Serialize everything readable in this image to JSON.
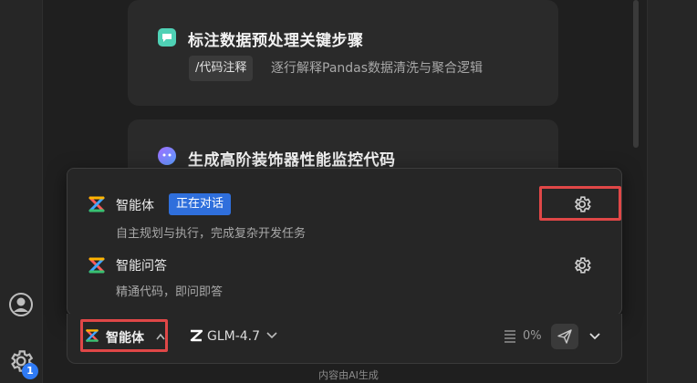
{
  "colors": {
    "accent": "#2f6fdc",
    "highlight": "#e04747",
    "badge": "#2f7bf6"
  },
  "sidebar": {
    "notification_count": "1"
  },
  "suggestions": [
    {
      "title": "标注数据预处理关键步骤",
      "command": "/代码注释",
      "description": "逐行解释Pandas数据清洗与聚合逻辑",
      "icon": "chat-bubble-icon"
    },
    {
      "title": "生成高阶装饰器性能监控代码",
      "icon": "sparkle-bubble-icon"
    }
  ],
  "mode_menu": {
    "options": [
      {
        "title": "智能体",
        "badge": "正在对话",
        "description": "自主规划与执行，完成复杂开发任务"
      },
      {
        "title": "智能问答",
        "description": "精通代码，即问即答"
      }
    ]
  },
  "input_bar": {
    "mode": "智能体",
    "model": "GLM-4.7",
    "context_usage": "0%"
  },
  "footer": {
    "note": "内容由AI生成"
  }
}
